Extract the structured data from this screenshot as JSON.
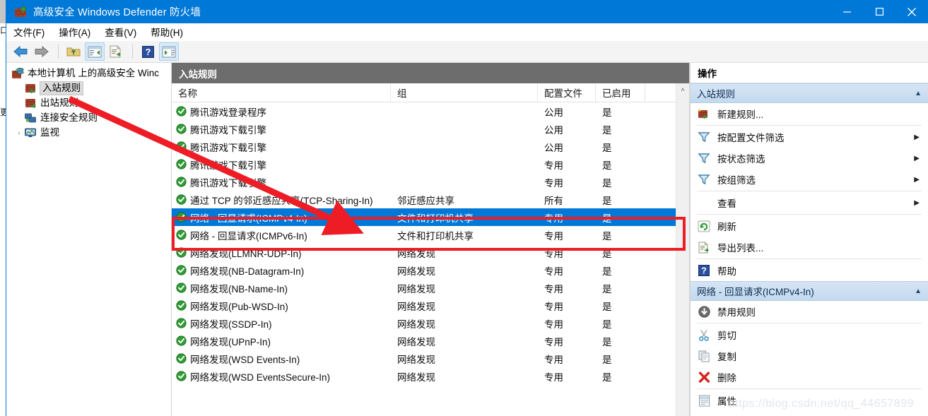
{
  "window": {
    "title": "高级安全 Windows Defender 防火墙",
    "icon": "firewall-brick-icon",
    "minimize_label": "—",
    "maximize_label": "☐",
    "close_label": "✕"
  },
  "menubar": [
    {
      "label": "文件(F)",
      "name": "menu-file"
    },
    {
      "label": "操作(A)",
      "name": "menu-action"
    },
    {
      "label": "查看(V)",
      "name": "menu-view"
    },
    {
      "label": "帮助(H)",
      "name": "menu-help"
    }
  ],
  "toolbar": [
    {
      "name": "back-arrow-icon",
      "title": "后退"
    },
    {
      "name": "forward-arrow-icon",
      "title": "前进"
    },
    {
      "name": "up-folder-icon",
      "title": "上移"
    },
    {
      "name": "show-tree-pane-icon",
      "title": "显示/隐藏控制台树"
    },
    {
      "name": "export-list-icon",
      "title": "导出列表"
    },
    {
      "name": "help-icon",
      "title": "帮助"
    },
    {
      "name": "show-action-pane-icon",
      "title": "显示/隐藏操作窗格"
    }
  ],
  "tree": {
    "root": {
      "label": "本地计算机 上的高级安全 Winc",
      "icon": "firewall-globe-icon"
    },
    "items": [
      {
        "label": "入站规则",
        "icon": "inbound-rules-icon",
        "selected": true
      },
      {
        "label": "出站规则",
        "icon": "outbound-rules-icon",
        "selected": false
      },
      {
        "label": "连接安全规则",
        "icon": "connection-security-icon",
        "selected": false
      },
      {
        "label": "监视",
        "icon": "monitoring-icon",
        "selected": false,
        "twisty": "›"
      }
    ]
  },
  "list": {
    "caption": "入站规则",
    "columns": [
      "名称",
      "组",
      "配置文件",
      "已启用"
    ],
    "scrollbar_up": "˄",
    "rows": [
      {
        "name": "腾讯游戏登录程序",
        "group": "",
        "profile": "公用",
        "enabled": "是",
        "selected": false
      },
      {
        "name": "腾讯游戏下载引擎",
        "group": "",
        "profile": "公用",
        "enabled": "是",
        "selected": false
      },
      {
        "name": "腾讯游戏下载引擎",
        "group": "",
        "profile": "公用",
        "enabled": "是",
        "selected": false
      },
      {
        "name": "腾讯游戏下载引擎",
        "group": "",
        "profile": "专用",
        "enabled": "是",
        "selected": false
      },
      {
        "name": "腾讯游戏下载引擎",
        "group": "",
        "profile": "专用",
        "enabled": "是",
        "selected": false
      },
      {
        "name": "通过 TCP 的邻近感应共享(TCP-Sharing-In)",
        "group": "邻近感应共享",
        "profile": "所有",
        "enabled": "是",
        "selected": false
      },
      {
        "name": "网络 - 回显请求(ICMPv4-In)",
        "group": "文件和打印机共享",
        "profile": "专用",
        "enabled": "是",
        "selected": true
      },
      {
        "name": "网络 - 回显请求(ICMPv6-In)",
        "group": "文件和打印机共享",
        "profile": "专用",
        "enabled": "是",
        "selected": false
      },
      {
        "name": "网络发现(LLMNR-UDP-In)",
        "group": "网络发现",
        "profile": "专用",
        "enabled": "是",
        "selected": false
      },
      {
        "name": "网络发现(NB-Datagram-In)",
        "group": "网络发现",
        "profile": "专用",
        "enabled": "是",
        "selected": false
      },
      {
        "name": "网络发现(NB-Name-In)",
        "group": "网络发现",
        "profile": "专用",
        "enabled": "是",
        "selected": false
      },
      {
        "name": "网络发现(Pub-WSD-In)",
        "group": "网络发现",
        "profile": "专用",
        "enabled": "是",
        "selected": false
      },
      {
        "name": "网络发现(SSDP-In)",
        "group": "网络发现",
        "profile": "专用",
        "enabled": "是",
        "selected": false
      },
      {
        "name": "网络发现(UPnP-In)",
        "group": "网络发现",
        "profile": "专用",
        "enabled": "是",
        "selected": false
      },
      {
        "name": "网络发现(WSD Events-In)",
        "group": "网络发现",
        "profile": "专用",
        "enabled": "是",
        "selected": false
      },
      {
        "name": "网络发现(WSD EventsSecure-In)",
        "group": "网络发现",
        "profile": "专用",
        "enabled": "是",
        "selected": false
      }
    ]
  },
  "actions": {
    "caption": "操作",
    "collapse_glyph": "▲",
    "submenu_glyph": "▶",
    "groups": [
      {
        "title": "入站规则",
        "items": [
          {
            "label": "新建规则...",
            "icon": "new-rule-icon",
            "submenu": false
          },
          {
            "label": "按配置文件筛选",
            "icon": "filter-icon",
            "submenu": true
          },
          {
            "label": "按状态筛选",
            "icon": "filter-icon",
            "submenu": true
          },
          {
            "label": "按组筛选",
            "icon": "filter-icon",
            "submenu": true
          },
          {
            "label": "查看",
            "icon": "",
            "submenu": true
          },
          {
            "label": "刷新",
            "icon": "refresh-icon",
            "submenu": false
          },
          {
            "label": "导出列表...",
            "icon": "export-list-icon",
            "submenu": false
          },
          {
            "label": "帮助",
            "icon": "help-icon",
            "submenu": false
          }
        ]
      },
      {
        "title": "网络 - 回显请求(ICMPv4-In)",
        "items": [
          {
            "label": "禁用规则",
            "icon": "disable-rule-icon",
            "submenu": false
          },
          {
            "label": "剪切",
            "icon": "cut-icon",
            "submenu": false
          },
          {
            "label": "复制",
            "icon": "copy-icon",
            "submenu": false
          },
          {
            "label": "删除",
            "icon": "delete-icon",
            "submenu": false
          },
          {
            "label": "属性",
            "icon": "properties-icon",
            "submenu": false
          }
        ]
      }
    ]
  },
  "annotations": {
    "watermark": "https://blog.csdn.net/qq_44657899",
    "highlight_color": "#ee1c25",
    "selection_color": "#0078d7"
  },
  "background_window": {
    "sliver_text_1": "口",
    "sliver_text_2": "更多"
  }
}
